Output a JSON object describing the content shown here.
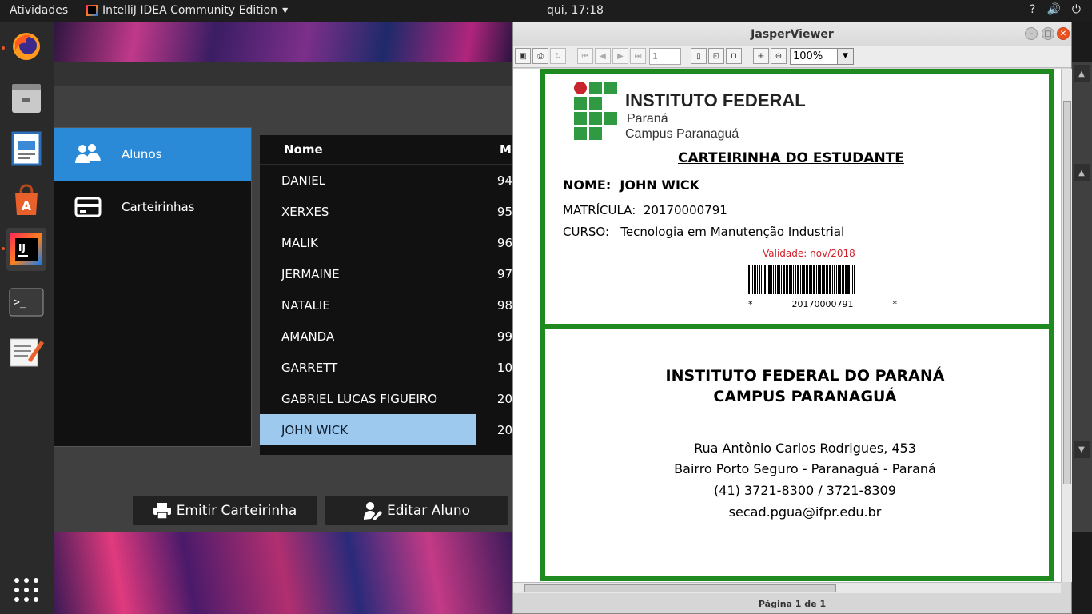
{
  "topbar": {
    "activities": "Atividades",
    "app_name": "IntelliJ IDEA Community Edition",
    "app_menu_arrow": "▾",
    "clock": "qui, 17:18",
    "tray": [
      "?",
      "🔊",
      "⏻"
    ]
  },
  "dock": {
    "items": [
      {
        "name": "firefox-icon",
        "glyph": "🦊"
      },
      {
        "name": "files-icon",
        "glyph": "🗄"
      },
      {
        "name": "writer-icon",
        "glyph": "📄"
      },
      {
        "name": "software-icon",
        "glyph": "A"
      },
      {
        "name": "intellij-icon",
        "glyph": "IJ"
      },
      {
        "name": "terminal-icon",
        "glyph": ">_"
      },
      {
        "name": "text-editor-icon",
        "glyph": "📝"
      },
      {
        "name": "show-apps-icon",
        "glyph": "⋮⋮⋮"
      }
    ]
  },
  "app": {
    "sidebar": [
      {
        "label": "Alunos",
        "icon": "users-icon",
        "selected": true
      },
      {
        "label": "Carteirinhas",
        "icon": "card-icon",
        "selected": false
      }
    ],
    "table": {
      "headers": [
        "Nome",
        "M"
      ],
      "rows": [
        {
          "nome": "DANIEL",
          "mat": "94"
        },
        {
          "nome": "XERXES",
          "mat": "95"
        },
        {
          "nome": "MALIK",
          "mat": "96"
        },
        {
          "nome": "JERMAINE",
          "mat": "97"
        },
        {
          "nome": "NATALIE",
          "mat": "98"
        },
        {
          "nome": "AMANDA",
          "mat": "99"
        },
        {
          "nome": "GARRETT",
          "mat": "10"
        },
        {
          "nome": "GABRIEL LUCAS FIGUEIRO",
          "mat": "20"
        },
        {
          "nome": "JOHN WICK",
          "mat": "20"
        }
      ],
      "selected_row": 8
    },
    "buttons": {
      "emitir": "Emitir Carteirinha",
      "editar": "Editar Aluno"
    }
  },
  "jasper": {
    "title": "JasperViewer",
    "page_field": "1",
    "zoom": "100%",
    "status": "Página 1 de 1",
    "card": {
      "logo_line1": "INSTITUTO FEDERAL",
      "logo_line2": "Paraná",
      "logo_line3": "Campus Paranaguá",
      "title": "CARTEIRINHA DO ESTUDANTE",
      "nome_label": "NOME:",
      "nome_value": "JOHN WICK",
      "matricula_label": "MATRÍCULA:",
      "matricula_value": "20170000791",
      "curso_label": "CURSO:",
      "curso_value": "Tecnologia em Manutenção Industrial",
      "validade": "Validade: nov/2018",
      "barcode_star": "*",
      "barcode_text": "20170000791"
    },
    "back": {
      "line1": "INSTITUTO FEDERAL DO PARANÁ",
      "line2": "CAMPUS PARANAGUÁ",
      "address": "Rua Antônio Carlos Rodrigues, 453",
      "district": "Bairro Porto Seguro - Paranaguá - Paraná",
      "phone": "(41) 3721-8300 / 3721-8309",
      "email": "secad.pgua@ifpr.edu.br"
    }
  },
  "colors": {
    "selection_blue": "#2b8ad8",
    "row_selected": "#9ec9ef",
    "card_border": "#1f8a1f",
    "validity_red": "#d0202a"
  }
}
